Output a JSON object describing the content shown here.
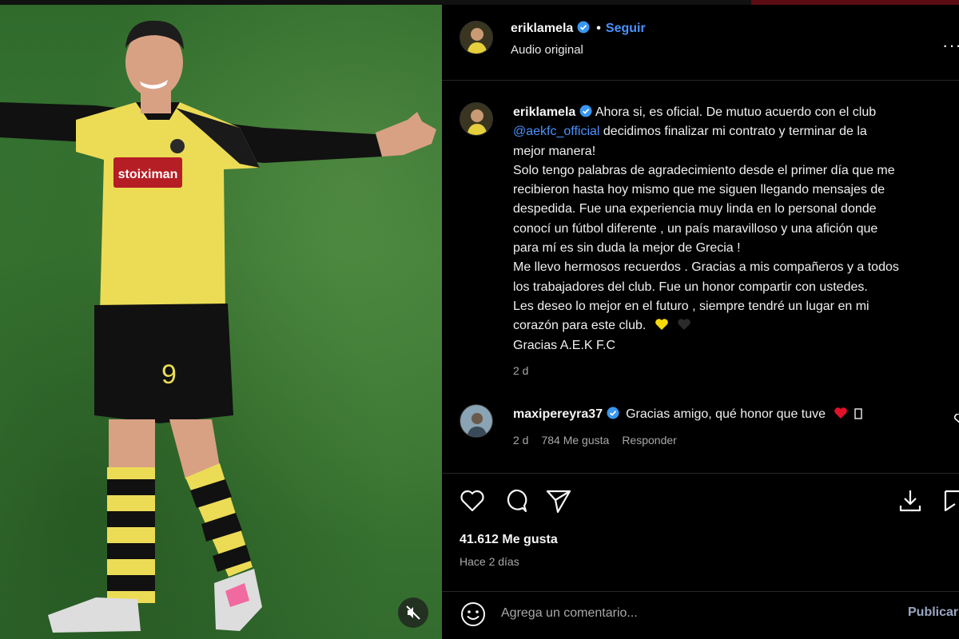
{
  "post": {
    "username": "eriklamela",
    "follow_label": "Seguir",
    "audio_label": "Audio original",
    "caption_lines": [
      "Ahora si, es oficial. De mutuo acuerdo con el club",
      "decidimos finalizar mi contrato y terminar de la",
      "mejor manera!",
      "Solo tengo palabras de agradecimiento desde el primer día que me",
      "recibieron hasta hoy mismo que me siguen llegando mensajes de",
      "despedida. Fue una experiencia muy linda en lo personal donde",
      "conocí un fútbol diferente , un país maravilloso y una afición que",
      "para mí es sin duda la mejor de Grecia !",
      "Me llevo hermosos recuerdos . Gracias a mis compañeros y a todos",
      "los trabajadores del club. Fue un honor compartir con ustedes.",
      "Les deseo lo mejor en el futuro , siempre tendré un lugar en mi",
      "corazón para este club.",
      "Gracias A.E.K F.C"
    ],
    "mention": "@aekfc_official",
    "caption_age": "2 d",
    "likes": "41.612 Me gusta",
    "posted_ago": "Hace 2 días"
  },
  "comment": {
    "username": "maxipereyra37",
    "text": "Gracias amigo, qué honor que tuve",
    "age": "2 d",
    "likes": "784 Me gusta",
    "reply_label": "Responder"
  },
  "comment_bar": {
    "placeholder": "Agrega un comentario...",
    "publish_label": "Publicar"
  },
  "colors": {
    "link_blue": "#4a92ff",
    "verified_blue": "#3897f0",
    "heart_red": "#e0122a",
    "heart_yellow": "#f5d90a"
  }
}
